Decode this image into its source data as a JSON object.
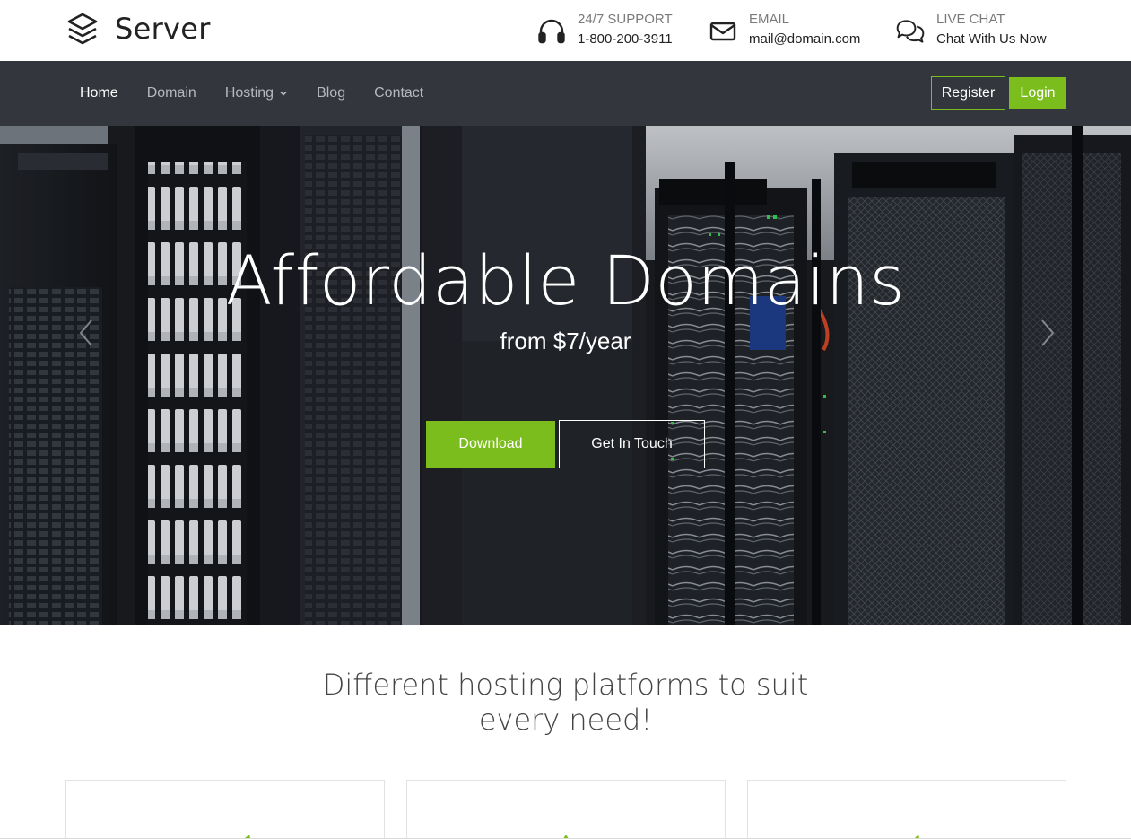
{
  "brand": {
    "name": "Server",
    "icon": "layers-icon"
  },
  "header": {
    "support": {
      "icon": "headphones-icon",
      "label": "24/7 SUPPORT",
      "value": "1-800-200-3911"
    },
    "email": {
      "icon": "envelope-icon",
      "label": "EMAIL",
      "value": "mail@domain.com"
    },
    "chat": {
      "icon": "chat-bubbles-icon",
      "label": "LIVE CHAT",
      "value": "Chat With Us Now"
    }
  },
  "nav": {
    "items": [
      {
        "label": "Home",
        "active": true
      },
      {
        "label": "Domain"
      },
      {
        "label": "Hosting",
        "dropdown": true
      },
      {
        "label": "Blog"
      },
      {
        "label": "Contact"
      }
    ],
    "register_label": "Register",
    "login_label": "Login"
  },
  "hero": {
    "title": "Affordable Domains",
    "subtitle": "from $7/year",
    "primary_button": "Download",
    "secondary_button": "Get In Touch",
    "prev_icon": "chevron-left-icon",
    "next_icon": "chevron-right-icon"
  },
  "section": {
    "title_line1": "Different hosting platforms to suit",
    "title_line2": "every need!"
  },
  "colors": {
    "accent": "#7cbd1e",
    "navbar": "#33363c",
    "text_dark": "#222222",
    "text_muted": "#7a7a7a"
  }
}
